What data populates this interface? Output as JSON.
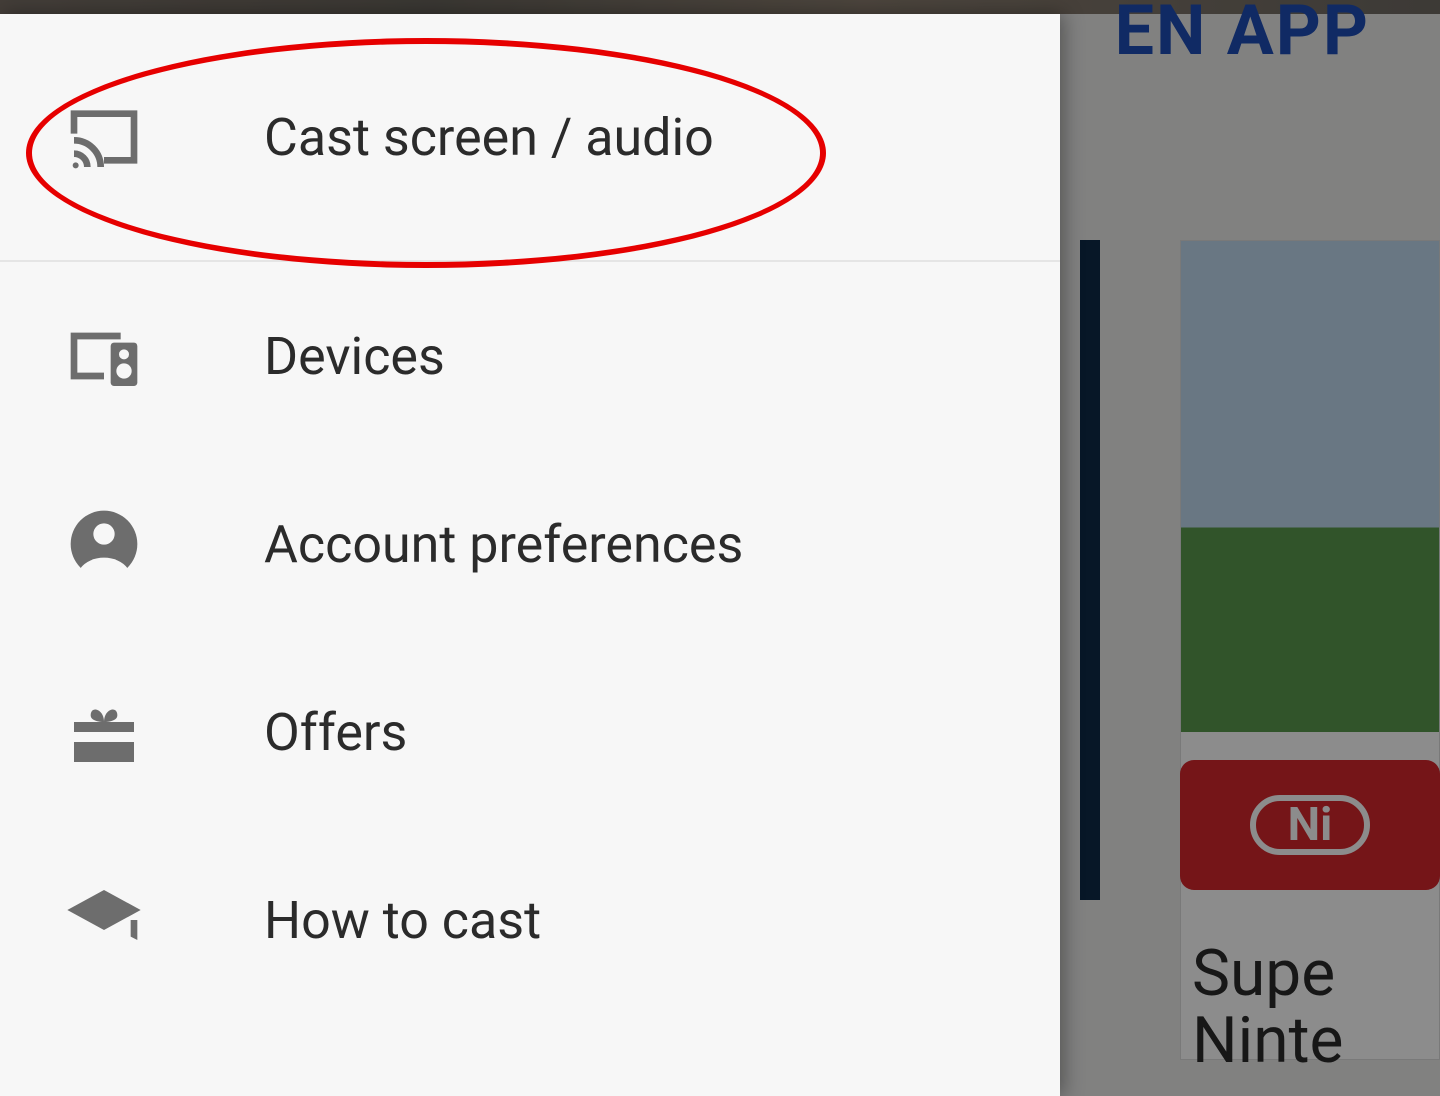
{
  "background": {
    "top_right_fragment": "EN APP",
    "badge_text": "Ni",
    "caption_line1": "Supe",
    "caption_line2": "Ninte"
  },
  "drawer": {
    "items": [
      {
        "label": "Cast screen / audio"
      },
      {
        "label": "Devices"
      },
      {
        "label": "Account preferences"
      },
      {
        "label": "Offers"
      },
      {
        "label": "How to cast"
      }
    ]
  },
  "annotation": {
    "highlighted_item_index": 0,
    "color": "#e60000"
  }
}
